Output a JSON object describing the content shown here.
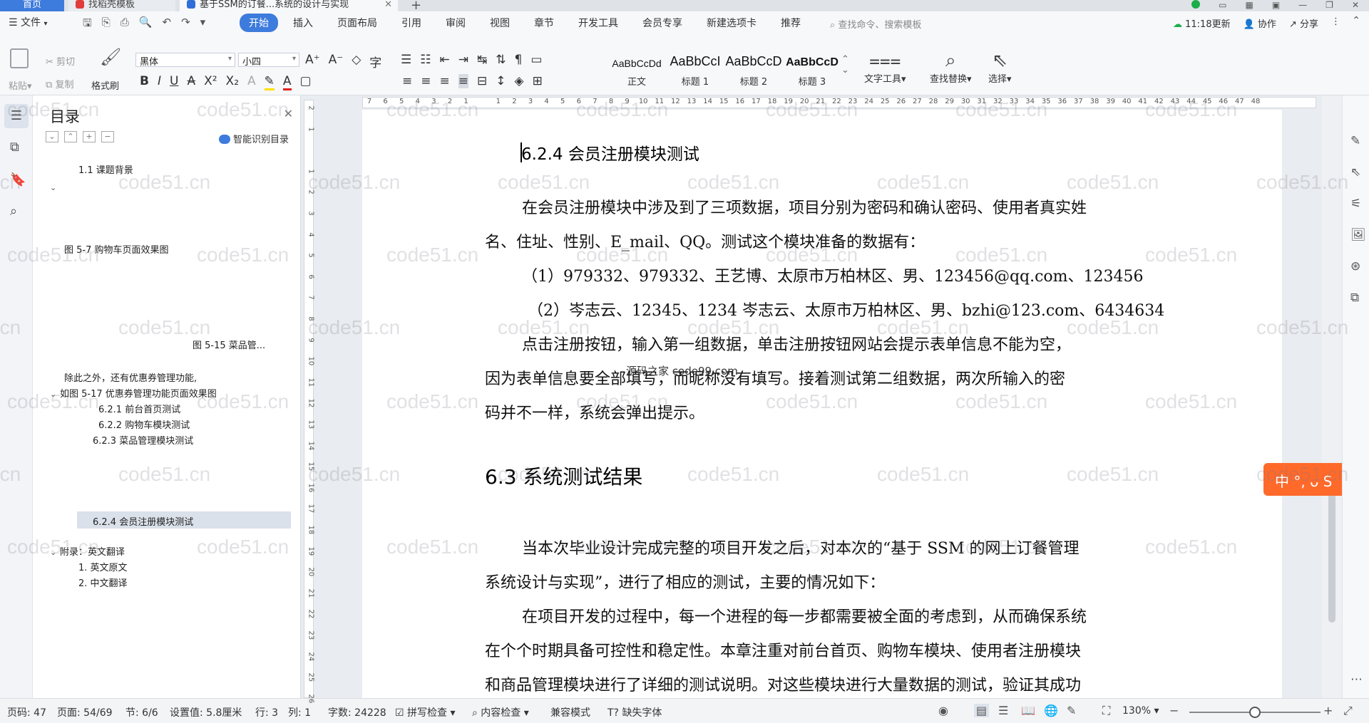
{
  "tabs": {
    "home": "首页",
    "docer": "找稻壳模板",
    "doc": "基于SSM的订餐...系统的设计与实现"
  },
  "menu": {
    "file": "文件",
    "items": [
      "开始",
      "插入",
      "页面布局",
      "引用",
      "审阅",
      "视图",
      "章节",
      "开发工具",
      "会员专享",
      "新建选项卡",
      "推荐"
    ],
    "search": "查找命令、搜索模板",
    "sync": "11:18更新",
    "collab": "协作",
    "share": "分享"
  },
  "ribbon": {
    "paste": "粘贴",
    "cut": "剪切",
    "copy": "复制",
    "format_painter": "格式刷",
    "font": "黑体",
    "size": "小四",
    "styles": [
      {
        "sample": "AaBbCcDd",
        "name": "正文"
      },
      {
        "sample": "AaBbCcI",
        "name": "标题 1"
      },
      {
        "sample": "AaBbCcD",
        "name": "标题 2"
      },
      {
        "sample": "AaBbCcD",
        "name": "标题 3"
      }
    ],
    "text_tools": "文字工具",
    "find_replace": "查找替换",
    "select": "选择"
  },
  "nav": {
    "title": "目录",
    "smart_toc": "智能识别目录",
    "items": [
      {
        "label": "1.1  课题背景"
      },
      {
        "label": "图 5-7 购物车页面效果图"
      },
      {
        "label": "图 5-15  菜品管..."
      },
      {
        "label": "除此之外，还有优惠券管理功能,"
      },
      {
        "label": "如图 5-17 优惠券管理功能页面效果图"
      },
      {
        "label": "6.2.1 前台首页测试"
      },
      {
        "label": "6.2.2 购物车模块测试"
      },
      {
        "label": "6.2.3 菜品管理模块测试"
      },
      {
        "label": "6.2.4 会员注册模块测试"
      },
      {
        "label": "附录：英文翻译"
      },
      {
        "label": "1. 英文原文"
      },
      {
        "label": "2. 中文翻译"
      }
    ]
  },
  "ruler": {
    "h_ticks": [
      "7",
      "6",
      "5",
      "4",
      "3",
      "2",
      "1",
      "",
      "1",
      "2",
      "3",
      "4",
      "5",
      "6",
      "7",
      "8",
      "9",
      "10",
      "11",
      "12",
      "13",
      "14",
      "15",
      "16",
      "17",
      "18",
      "19",
      "20",
      "21",
      "22",
      "23",
      "24",
      "25",
      "26",
      "27",
      "28",
      "29",
      "30",
      "31",
      "32",
      "33",
      "34",
      "35",
      "36",
      "37",
      "38",
      "39",
      "40",
      "41",
      "42",
      "43",
      "44",
      "45",
      "46",
      "47",
      "48"
    ],
    "v_ticks": [
      "2",
      "1",
      "",
      "1",
      "2",
      "3",
      "4",
      "5",
      "6",
      "7",
      "8",
      "9",
      "10",
      "11",
      "12",
      "13",
      "14",
      "15",
      "16",
      "17",
      "18",
      "19",
      "20",
      "21",
      "22",
      "23",
      "24",
      "25",
      "26"
    ]
  },
  "document": {
    "heading_624": "6.2.4 会员注册模块测试",
    "p1_l1": "在会员注册模块中涉及到了三项数据，项目分别为密码和确认密码、使用者真实姓",
    "p1_l2": "名、住址、性别、E_mail、QQ。测试这个模块准备的数据有：",
    "p2": "（1）979332、979332、王艺博、太原市万柏林区、男、123456@qq.com、123456",
    "p3": "（2）岑志云、12345、1234 岑志云、太原市万柏林区、男、bzhi@123.com、6434634",
    "p4_l1": "点击注册按钮，输入第一组数据，单击注册按钮网站会提示表单信息不能为空，",
    "p4_l2": "因为表单信息要全部填写，而昵称没有填写。接着测试第二组数据，两次所输入的密",
    "p4_l3": "码并不一样，系统会弹出提示。",
    "overlay": "源码之家 code99.com",
    "heading_63": "6.3  系统测试结果",
    "p5_l1": "当本次毕业设计完成完整的项目开发之后，对本次的“基于 SSM 的网上订餐管理",
    "p5_l2": "系统设计与实现”，进行了相应的测试，主要的情况如下：",
    "p6_l1": "在项目开发的过程中，每一个进程的每一步都需要被全面的考虑到，从而确保系统",
    "p6_l2": "在个个时期具备可控性和稳定性。本章注重对前台首页、购物车模块、使用者注册模块",
    "p6_l3": "和商品管理模块进行了详细的测试说明。对这些模块进行大量数据的测试，验证其成功"
  },
  "watermark": "code51.cn",
  "ime": "中 °, ᴗ S",
  "status": {
    "page_num": "页码: 47",
    "page_of": "页面: 54/69",
    "section": "节: 6/6",
    "setting": "设置值: 5.8厘米",
    "row": "行: 3",
    "col": "列: 1",
    "words": "字数: 24228",
    "spell": "拼写检查",
    "content": "内容检查",
    "compat": "兼容模式",
    "missing_font": "缺失字体",
    "zoom": "130%"
  },
  "colors": {
    "accent": "#3d7bdc",
    "ime": "#ff6a2b"
  }
}
